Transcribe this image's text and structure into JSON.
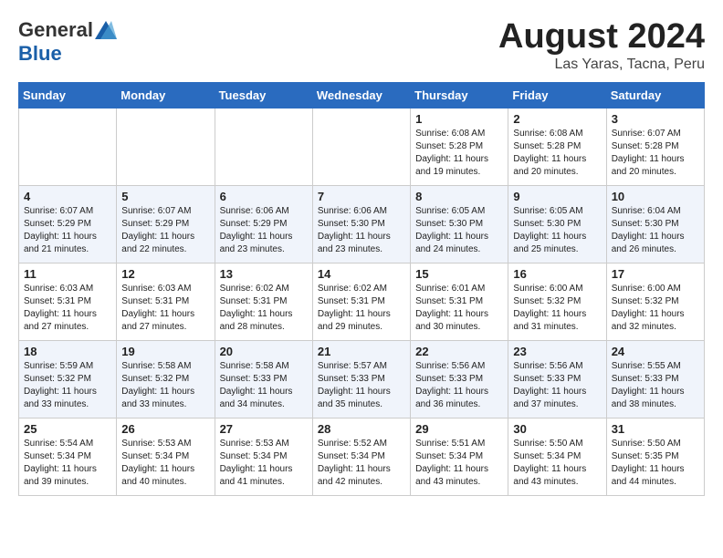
{
  "header": {
    "logo_general": "General",
    "logo_blue": "Blue",
    "month_year": "August 2024",
    "location": "Las Yaras, Tacna, Peru"
  },
  "days_of_week": [
    "Sunday",
    "Monday",
    "Tuesday",
    "Wednesday",
    "Thursday",
    "Friday",
    "Saturday"
  ],
  "weeks": [
    [
      {
        "day": "",
        "info": ""
      },
      {
        "day": "",
        "info": ""
      },
      {
        "day": "",
        "info": ""
      },
      {
        "day": "",
        "info": ""
      },
      {
        "day": "1",
        "info": "Sunrise: 6:08 AM\nSunset: 5:28 PM\nDaylight: 11 hours and 19 minutes."
      },
      {
        "day": "2",
        "info": "Sunrise: 6:08 AM\nSunset: 5:28 PM\nDaylight: 11 hours and 20 minutes."
      },
      {
        "day": "3",
        "info": "Sunrise: 6:07 AM\nSunset: 5:28 PM\nDaylight: 11 hours and 20 minutes."
      }
    ],
    [
      {
        "day": "4",
        "info": "Sunrise: 6:07 AM\nSunset: 5:29 PM\nDaylight: 11 hours and 21 minutes."
      },
      {
        "day": "5",
        "info": "Sunrise: 6:07 AM\nSunset: 5:29 PM\nDaylight: 11 hours and 22 minutes."
      },
      {
        "day": "6",
        "info": "Sunrise: 6:06 AM\nSunset: 5:29 PM\nDaylight: 11 hours and 23 minutes."
      },
      {
        "day": "7",
        "info": "Sunrise: 6:06 AM\nSunset: 5:30 PM\nDaylight: 11 hours and 23 minutes."
      },
      {
        "day": "8",
        "info": "Sunrise: 6:05 AM\nSunset: 5:30 PM\nDaylight: 11 hours and 24 minutes."
      },
      {
        "day": "9",
        "info": "Sunrise: 6:05 AM\nSunset: 5:30 PM\nDaylight: 11 hours and 25 minutes."
      },
      {
        "day": "10",
        "info": "Sunrise: 6:04 AM\nSunset: 5:30 PM\nDaylight: 11 hours and 26 minutes."
      }
    ],
    [
      {
        "day": "11",
        "info": "Sunrise: 6:03 AM\nSunset: 5:31 PM\nDaylight: 11 hours and 27 minutes."
      },
      {
        "day": "12",
        "info": "Sunrise: 6:03 AM\nSunset: 5:31 PM\nDaylight: 11 hours and 27 minutes."
      },
      {
        "day": "13",
        "info": "Sunrise: 6:02 AM\nSunset: 5:31 PM\nDaylight: 11 hours and 28 minutes."
      },
      {
        "day": "14",
        "info": "Sunrise: 6:02 AM\nSunset: 5:31 PM\nDaylight: 11 hours and 29 minutes."
      },
      {
        "day": "15",
        "info": "Sunrise: 6:01 AM\nSunset: 5:31 PM\nDaylight: 11 hours and 30 minutes."
      },
      {
        "day": "16",
        "info": "Sunrise: 6:00 AM\nSunset: 5:32 PM\nDaylight: 11 hours and 31 minutes."
      },
      {
        "day": "17",
        "info": "Sunrise: 6:00 AM\nSunset: 5:32 PM\nDaylight: 11 hours and 32 minutes."
      }
    ],
    [
      {
        "day": "18",
        "info": "Sunrise: 5:59 AM\nSunset: 5:32 PM\nDaylight: 11 hours and 33 minutes."
      },
      {
        "day": "19",
        "info": "Sunrise: 5:58 AM\nSunset: 5:32 PM\nDaylight: 11 hours and 33 minutes."
      },
      {
        "day": "20",
        "info": "Sunrise: 5:58 AM\nSunset: 5:33 PM\nDaylight: 11 hours and 34 minutes."
      },
      {
        "day": "21",
        "info": "Sunrise: 5:57 AM\nSunset: 5:33 PM\nDaylight: 11 hours and 35 minutes."
      },
      {
        "day": "22",
        "info": "Sunrise: 5:56 AM\nSunset: 5:33 PM\nDaylight: 11 hours and 36 minutes."
      },
      {
        "day": "23",
        "info": "Sunrise: 5:56 AM\nSunset: 5:33 PM\nDaylight: 11 hours and 37 minutes."
      },
      {
        "day": "24",
        "info": "Sunrise: 5:55 AM\nSunset: 5:33 PM\nDaylight: 11 hours and 38 minutes."
      }
    ],
    [
      {
        "day": "25",
        "info": "Sunrise: 5:54 AM\nSunset: 5:34 PM\nDaylight: 11 hours and 39 minutes."
      },
      {
        "day": "26",
        "info": "Sunrise: 5:53 AM\nSunset: 5:34 PM\nDaylight: 11 hours and 40 minutes."
      },
      {
        "day": "27",
        "info": "Sunrise: 5:53 AM\nSunset: 5:34 PM\nDaylight: 11 hours and 41 minutes."
      },
      {
        "day": "28",
        "info": "Sunrise: 5:52 AM\nSunset: 5:34 PM\nDaylight: 11 hours and 42 minutes."
      },
      {
        "day": "29",
        "info": "Sunrise: 5:51 AM\nSunset: 5:34 PM\nDaylight: 11 hours and 43 minutes."
      },
      {
        "day": "30",
        "info": "Sunrise: 5:50 AM\nSunset: 5:34 PM\nDaylight: 11 hours and 43 minutes."
      },
      {
        "day": "31",
        "info": "Sunrise: 5:50 AM\nSunset: 5:35 PM\nDaylight: 11 hours and 44 minutes."
      }
    ]
  ]
}
